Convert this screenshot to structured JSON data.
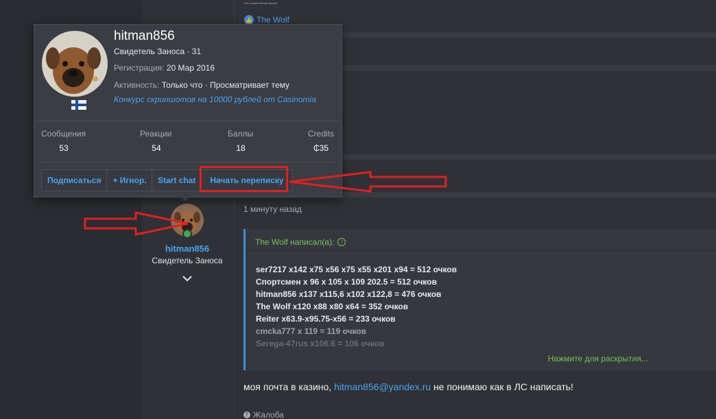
{
  "background_post": {
    "tiny_text": "Кто-то уже в блоке ничего",
    "reaction_user": "The Wolf",
    "time_ago": "1 минуту назад",
    "quote": {
      "author_line": "The Wolf написал(а):",
      "lines": [
        "ser7217 x142 x75 x56 x75 x55 x201 x94 = 512 очков",
        "Спортсмен x 96 x 105 x 109 202.5 = 512 очков",
        "hitman856 x137 x115,6 x102 x122,8 = 476 очков",
        "The Wolf x120 x88 x80 x64 = 352 очков",
        "Reiter x63.9-x95.75-x56 = 233 очков",
        "cmcka777 x 119 = 119 очков",
        "Serega-47rus x106.6 = 106 очков"
      ],
      "expand": "Нажмите для раскрытия..."
    },
    "message_before": "моя почта в казино, ",
    "message_link": "hitman856@yandex.ru",
    "message_after": " не понимаю как в ЛС написать!",
    "report": "Жалоба"
  },
  "author": {
    "name": "hitman856",
    "title": "Свидетель Заноса"
  },
  "popup": {
    "username": "hitman856",
    "subtitle": "Свидетель Заноса · 31",
    "reg_label": "Регистрация:",
    "reg_value": "20 Мар 2016",
    "activity_label": "Активность:",
    "activity_value": "Только что · Просматривает тему",
    "promo": "Конкурс скриншотов на 10000 рублей от Casinomia",
    "stats": [
      {
        "label": "Сообщения",
        "value": "53"
      },
      {
        "label": "Реакции",
        "value": "54"
      },
      {
        "label": "Баллы",
        "value": "18"
      },
      {
        "label": "Credits",
        "value": "₵35"
      }
    ],
    "buttons": {
      "subscribe": "Подписаться",
      "ignore": "+ Игнор.",
      "start_chat": "Start chat",
      "start_conversation": "Начать переписку"
    }
  },
  "colors": {
    "link": "#4aa3ee",
    "green": "#7ac25b",
    "highlight": "#e0201f"
  }
}
